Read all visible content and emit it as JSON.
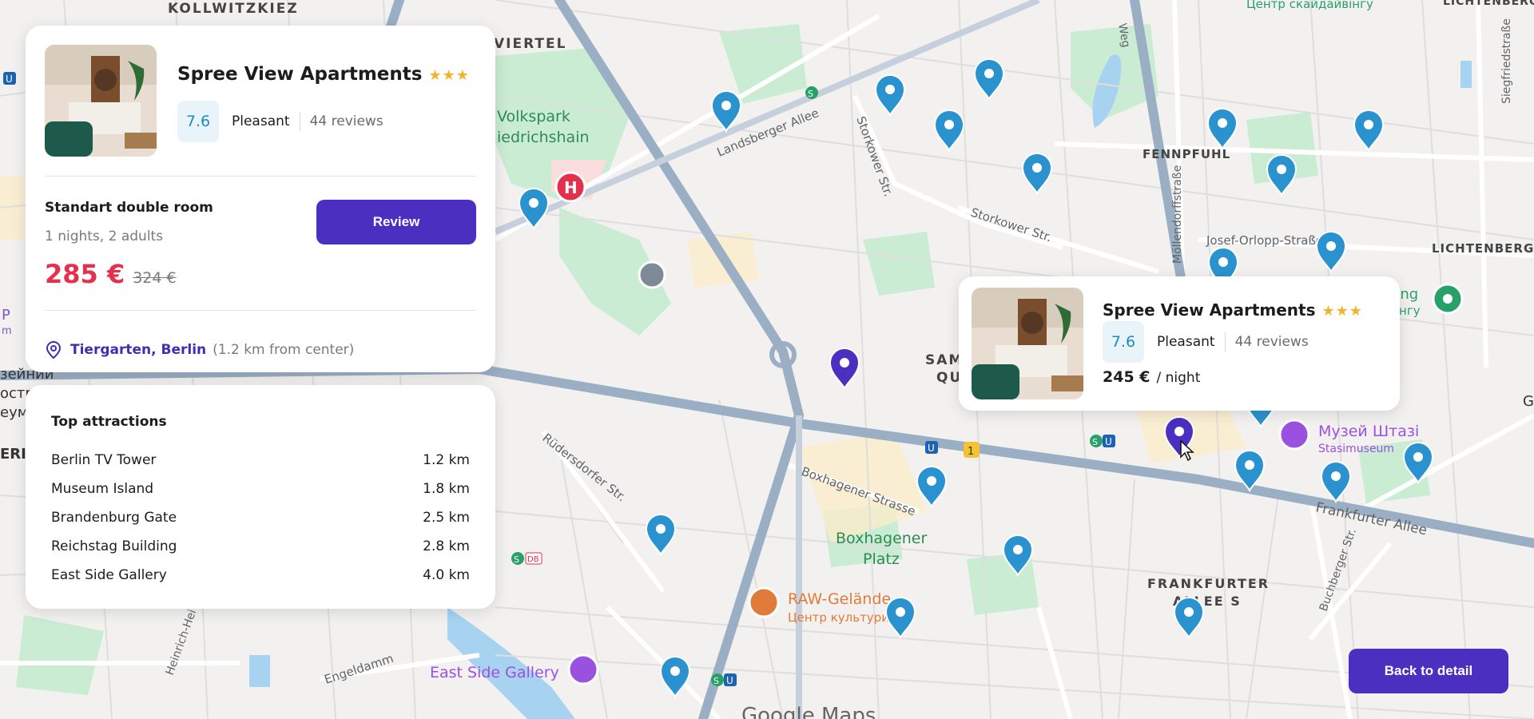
{
  "map": {
    "labels": {
      "viertel": "VIERTEL",
      "kollwitzkiez": "KOLLWITZKIEZ",
      "volkspark": "Volkspark",
      "friedrichshain": "iedrichshain",
      "landsberger": "Landsberger Allee",
      "storkower1": "Storkower Str.",
      "storkower2": "Storkower Str.",
      "fennpfuhl": "FENNPFUHL",
      "moellendorff": "Möllendorffstraße",
      "josef_orlopp": "Josef-Orlopp-Straße",
      "lichtenberg": "LICHTENBERG",
      "lichtenberg_top": "LICHTENBERG",
      "siegfried": "Siegfriedstraße",
      "diving": "Центр скайдайвінгу",
      "sing1": "sing",
      "sing2": "вінгу",
      "weg": "Weg",
      "samaritern1": "SAM",
      "samaritern2": "QU",
      "ruedersdorfer": "Rüdersdorfer Str.",
      "boxhagener_str": "Boxhagener Strasse",
      "boxhagener_platz1": "Boxhagener",
      "boxhagener_platz2": "Platz",
      "raw1": "RAW-Gelände",
      "raw2": "Центр культури",
      "east_side": "East Side Gallery",
      "frankfurter_allee": "Frankfurter Allee",
      "frankfurter_s1": "FRANKFURTER",
      "frankfurter_s2": "ALLEE S",
      "stasi1": "Музей Штазі",
      "stasi2": "Stasimuseum",
      "buchberger": "Buchberger Str.",
      "heinrich": "Heinrich-Hei",
      "engeldamm": "Engeldamm",
      "google": "Google Maps",
      "left1": "зейнии",
      "left2": "остр",
      "left3": "еум",
      "left4": "ERI",
      "road_badge": "1",
      "db": "DB",
      "u": "U",
      "s": "S",
      "h": "H",
      "g": "G",
      "p": "P",
      "m": "m"
    }
  },
  "hotel": {
    "name": "Spree View Apartments",
    "stars": "★★★",
    "score": "7.6",
    "score_word": "Pleasant",
    "reviews": "44 reviews",
    "room_type": "Standart double room",
    "room_meta": "1 nights, 2 adults",
    "price": "285 €",
    "old_price": "324 €",
    "review_label": "Review",
    "location_name": "Tiergarten, Berlin",
    "location_distance": "(1.2 km from center)"
  },
  "attractions": {
    "title": "Top attractions",
    "items": [
      {
        "name": "Berlin TV Tower",
        "distance": "1.2 km"
      },
      {
        "name": "Museum Island",
        "distance": "1.8 km"
      },
      {
        "name": "Brandenburg Gate",
        "distance": "2.5 km"
      },
      {
        "name": "Reichstag Building",
        "distance": "2.8 km"
      },
      {
        "name": "East Side Gallery",
        "distance": "4.0 km"
      }
    ]
  },
  "popup": {
    "name": "Spree View Apartments",
    "stars": "★★★",
    "score": "7.6",
    "score_word": "Pleasant",
    "reviews": "44 reviews",
    "price": "245 €",
    "unit": "/ night"
  },
  "back_label": "Back to detail",
  "colors": {
    "accent": "#4a2fc0",
    "price": "#e4304d",
    "pin_blue": "#2a93cf",
    "pin_purple": "#4a2fc0",
    "score_bg": "#e9f4fa"
  }
}
